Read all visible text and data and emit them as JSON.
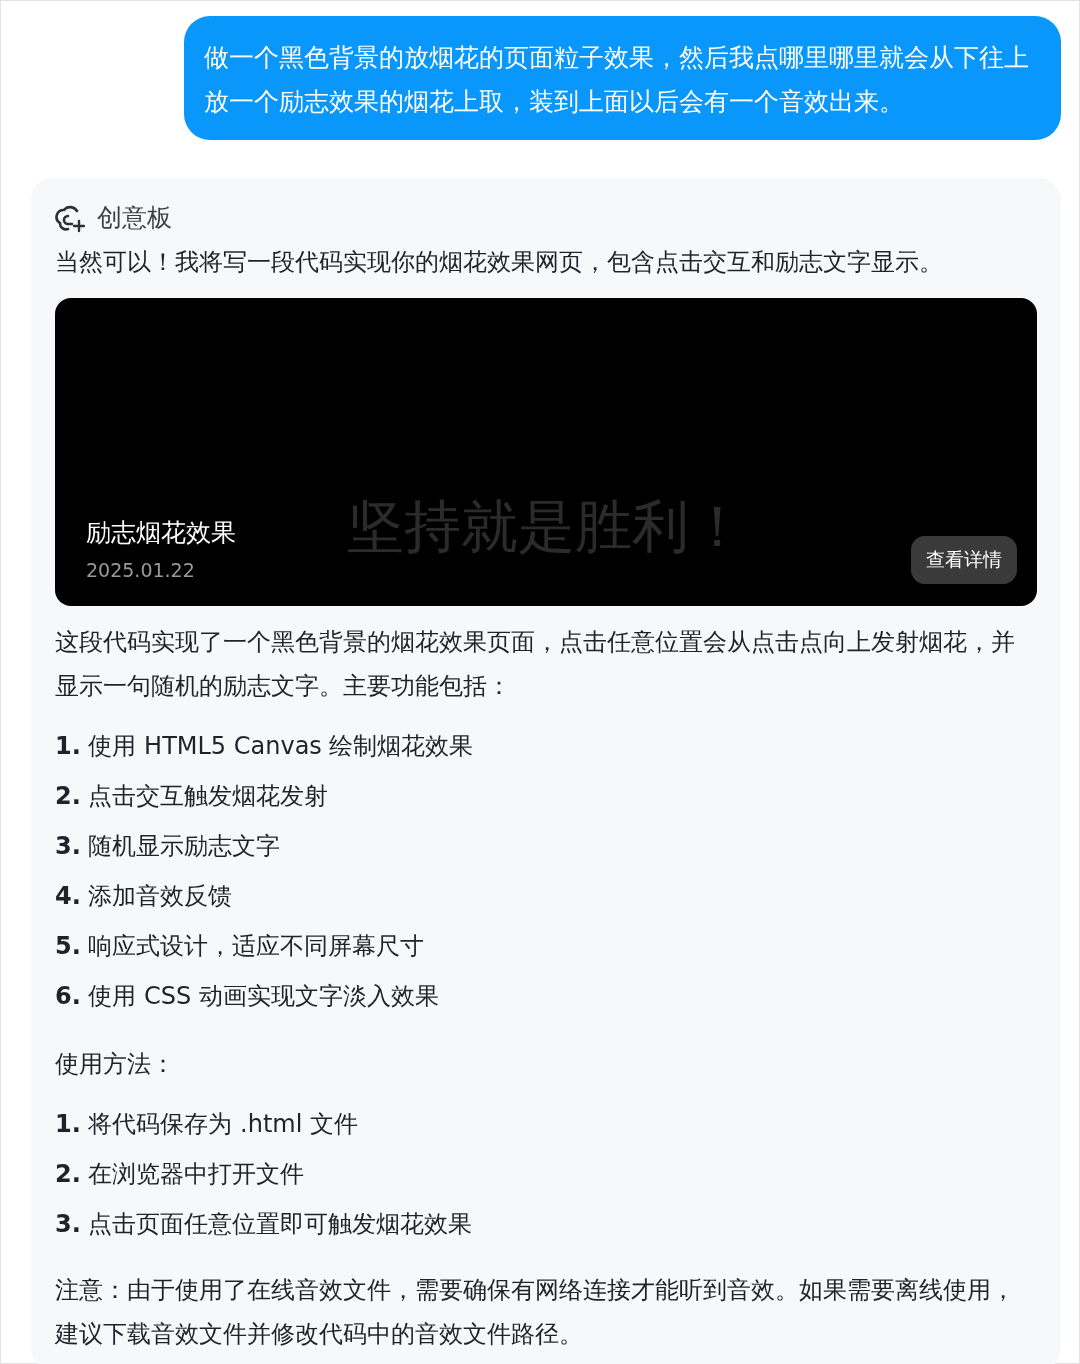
{
  "user_message": "做一个黑色背景的放烟花的页面粒子效果，然后我点哪里哪里就会从下往上放一个励志效果的烟花上取，装到上面以后会有一个音效出来。",
  "assistant": {
    "header": {
      "label": "创意板"
    },
    "intro": "当然可以！我将写一段代码实现你的烟花效果网页，包含点击交互和励志文字显示。",
    "preview_card": {
      "title": "励志烟花效果",
      "date": "2025.01.22",
      "overlay_text": "坚持就是胜利！",
      "button": "查看详情"
    },
    "summary": "这段代码实现了一个黑色背景的烟花效果页面，点击任意位置会从点击点向上发射烟花，并显示一句随机的励志文字。主要功能包括：",
    "features": [
      {
        "number": "1.",
        "text": "使用 HTML5 Canvas 绘制烟花效果"
      },
      {
        "number": "2.",
        "text": "点击交互触发烟花发射"
      },
      {
        "number": "3.",
        "text": "随机显示励志文字"
      },
      {
        "number": "4.",
        "text": "添加音效反馈"
      },
      {
        "number": "5.",
        "text": "响应式设计，适应不同屏幕尺寸"
      },
      {
        "number": "6.",
        "text": "使用 CSS 动画实现文字淡入效果"
      }
    ],
    "usage_heading": "使用方法：",
    "usage_steps": [
      {
        "number": "1.",
        "text": "将代码保存为 .html 文件"
      },
      {
        "number": "2.",
        "text": "在浏览器中打开文件"
      },
      {
        "number": "3.",
        "text": "点击页面任意位置即可触发烟花效果"
      }
    ],
    "note": "注意：由于使用了在线音效文件，需要确保有网络连接才能听到音效。如果需要离线使用，建议下载音效文件并修改代码中的音效文件路径。"
  }
}
